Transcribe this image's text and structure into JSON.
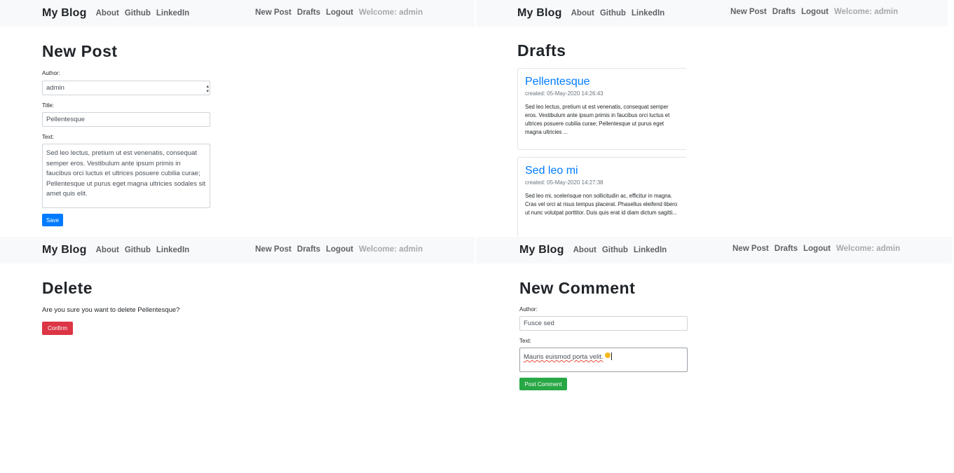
{
  "nav": {
    "brand": "My Blog",
    "left_links": [
      "About",
      "Github",
      "LinkedIn"
    ],
    "right_links": [
      "New Post",
      "Drafts",
      "Logout"
    ],
    "welcome": "Welcome: admin"
  },
  "new_post": {
    "title": "New Post",
    "author_label": "Author:",
    "author_value": "admin",
    "title_label": "Title:",
    "title_value": "Pellentesque",
    "text_label": "Text:",
    "text_value": "Sed leo lectus, pretium ut est venenatis, consequat semper eros. Vestibulum ante ipsum primis in faucibus orci luctus et ultrices posuere cubilia curae; Pellentesque ut purus eget magna ultricies sodales sit amet quis elit.",
    "save_label": "Save"
  },
  "drafts": {
    "title": "Drafts",
    "items": [
      {
        "title": "Pellentesque",
        "created": "created: 05-May-2020 14:26:43",
        "excerpt": "Sed leo lectus, pretium ut est venenatis, consequat semper eros. Vestibulum ante ipsum primis in faucibus orci luctus et ultrices posuere cubilia curae; Pellentesque ut purus eget magna ultricies ..."
      },
      {
        "title": "Sed leo mi",
        "created": "created: 05-May-2020 14:27:38",
        "excerpt": "Sed leo mi, scelerisque non sollicitudin ac, efficitur in magna. Cras vel orci at risus tempus placerat. Phasellus eleifend libero ut nunc volutpat porttitor. Duis quis erat id diam dictum sagitti..."
      }
    ]
  },
  "delete": {
    "title": "Delete",
    "question": "Are you sure you want to delete Pellentesque?",
    "confirm_label": "Confirm"
  },
  "new_comment": {
    "title": "New Comment",
    "author_label": "Author:",
    "author_value": "Fusce sed",
    "text_label": "Text:",
    "text_value": "Mauris euismod porta velit.",
    "post_label": "Post Comment"
  },
  "icons": {
    "select_caret": "chevron-updown-icon",
    "emoji": "smiling-face-emoji"
  },
  "colors": {
    "primary": "#007bff",
    "danger": "#dc3545",
    "success": "#28a745",
    "navbar_bg": "#f8f9fa"
  }
}
